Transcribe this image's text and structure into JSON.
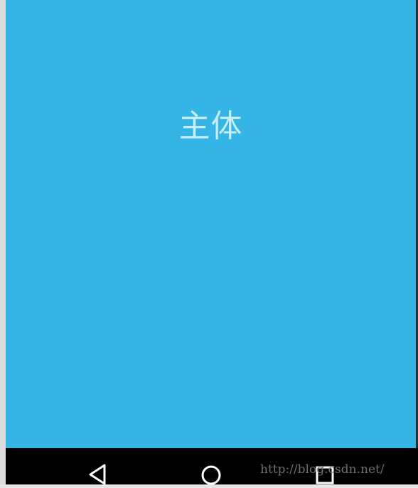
{
  "screen": {
    "background_color": "#34b5e5",
    "main_label": "主体",
    "label_color": "#c9eefb"
  },
  "navigation_bar": {
    "background_color": "#000000",
    "buttons": [
      {
        "name": "back",
        "icon": "back-triangle-icon"
      },
      {
        "name": "home",
        "icon": "home-circle-icon"
      },
      {
        "name": "recent",
        "icon": "recent-apps-square-icon"
      }
    ]
  },
  "watermark": {
    "text": "http://blog.csdn.net/"
  }
}
